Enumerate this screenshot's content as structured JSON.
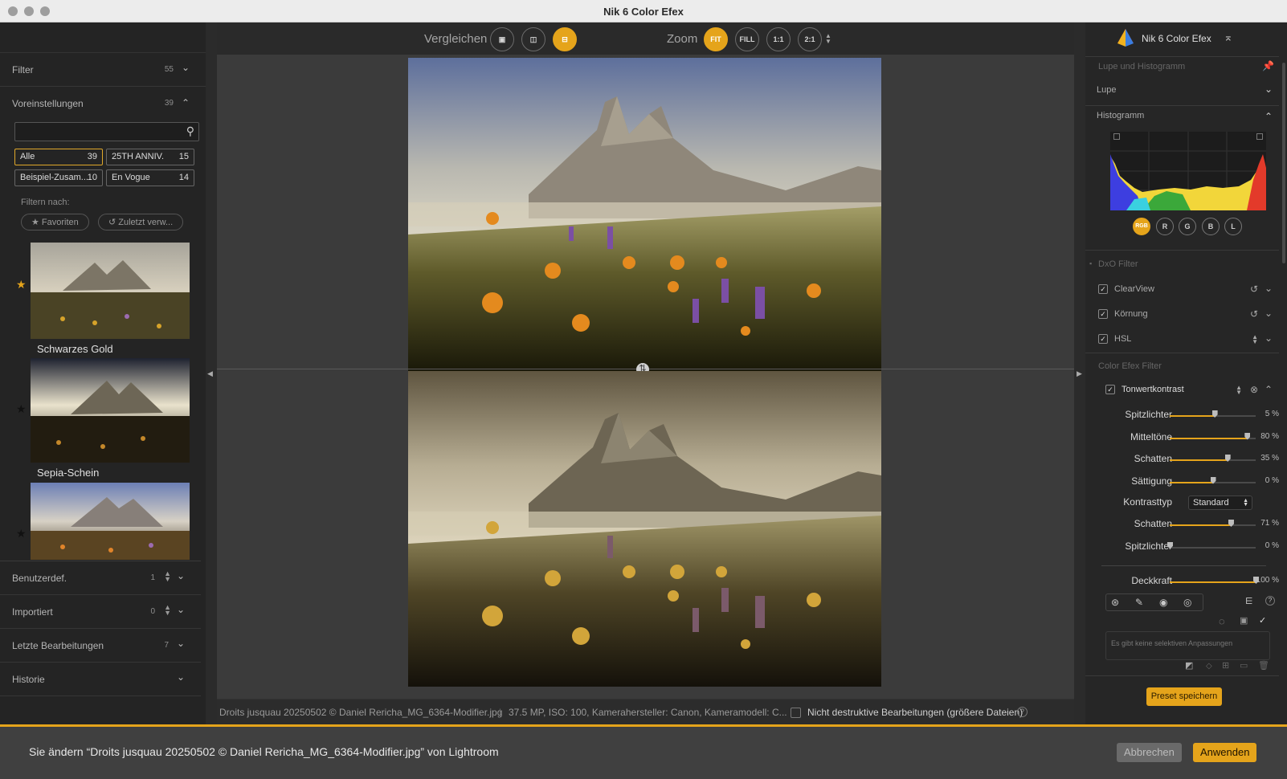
{
  "window": {
    "title": "Nik 6 Color Efex"
  },
  "left_panel": {
    "filter": {
      "label": "Filter",
      "count": "55"
    },
    "presets": {
      "label": "Voreinstellungen",
      "count": "39"
    },
    "search": {
      "placeholder": ""
    },
    "tags": [
      {
        "label": "Alle",
        "count": "39"
      },
      {
        "label": "25TH ANNIV.",
        "count": "15"
      },
      {
        "label": "Beispiel-Zusam...",
        "count": "10"
      },
      {
        "label": "En Vogue",
        "count": "14"
      }
    ],
    "filter_by": "Filtern nach:",
    "pills": {
      "favorites": "Favoriten",
      "recent": "Zuletzt verw..."
    },
    "preset_items": [
      {
        "name": "Schwarzes Gold",
        "favorite": true
      },
      {
        "name": "Sepia-Schein",
        "favorite": false
      },
      {
        "name": "",
        "favorite": false
      }
    ],
    "sections": [
      {
        "label": "Benutzerdef.",
        "count": "1"
      },
      {
        "label": "Importiert",
        "count": "0"
      },
      {
        "label": "Letzte Bearbeitungen",
        "count": "7"
      },
      {
        "label": "Historie",
        "count": ""
      }
    ]
  },
  "toolbar": {
    "compare_label": "Vergleichen",
    "zoom_label": "Zoom",
    "zoom_fit": "FIT",
    "zoom_fill": "FILL",
    "zoom_1_1": "1:1",
    "zoom_2_1": "2:1"
  },
  "status_bar": {
    "filename": "Droits jusquau 20250502 © Daniel Rericha_MG_6364-Modifier.jpg",
    "meta": "37.5 MP, ISO: 100, Kamerahersteller: Canon, Kameramodell: C...",
    "nondestructive": "Nicht destruktive Bearbeitungen (größere Dateien)"
  },
  "right_panel": {
    "brand": "Nik 6 Color Efex",
    "loupe_hist_header": "Lupe und Histogramm",
    "loupe": "Lupe",
    "histogram": "Histogramm",
    "channels": [
      "RGB",
      "R",
      "G",
      "B",
      "L"
    ],
    "dxo_header": "DxO Filter",
    "dxo_filters": [
      "ClearView",
      "Körnung",
      "HSL"
    ],
    "color_efex_header": "Color Efex Filter",
    "active_filter": "Tonwertkontrast",
    "sliders": [
      {
        "label": "Spitzlichter",
        "value": "5 %",
        "level": 0.52
      },
      {
        "label": "Mitteltöne",
        "value": "80 %",
        "level": 0.9
      },
      {
        "label": "Schatten",
        "value": "35 %",
        "level": 0.67
      },
      {
        "label": "Sättigung",
        "value": "0 %",
        "level": 0.5
      }
    ],
    "contrast_type_label": "Kontrasttyp",
    "contrast_type_value": "Standard",
    "sliders2": [
      {
        "label": "Schatten",
        "value": "71 %",
        "level": 0.71
      },
      {
        "label": "Spitzlichter",
        "value": "0 %",
        "level": 0.0
      }
    ],
    "opacity": {
      "label": "Deckkraft",
      "value": "100 %",
      "level": 1.0
    },
    "no_selective": "Es gibt keine selektiven Anpassungen",
    "save_preset": "Preset speichern"
  },
  "bottom_bar": {
    "message": "Sie ändern “Droits jusquau 20250502 © Daniel Rericha_MG_6364-Modifier.jpg” von Lightroom",
    "cancel": "Abbrechen",
    "apply": "Anwenden"
  },
  "colors": {
    "accent": "#e5a41b"
  }
}
